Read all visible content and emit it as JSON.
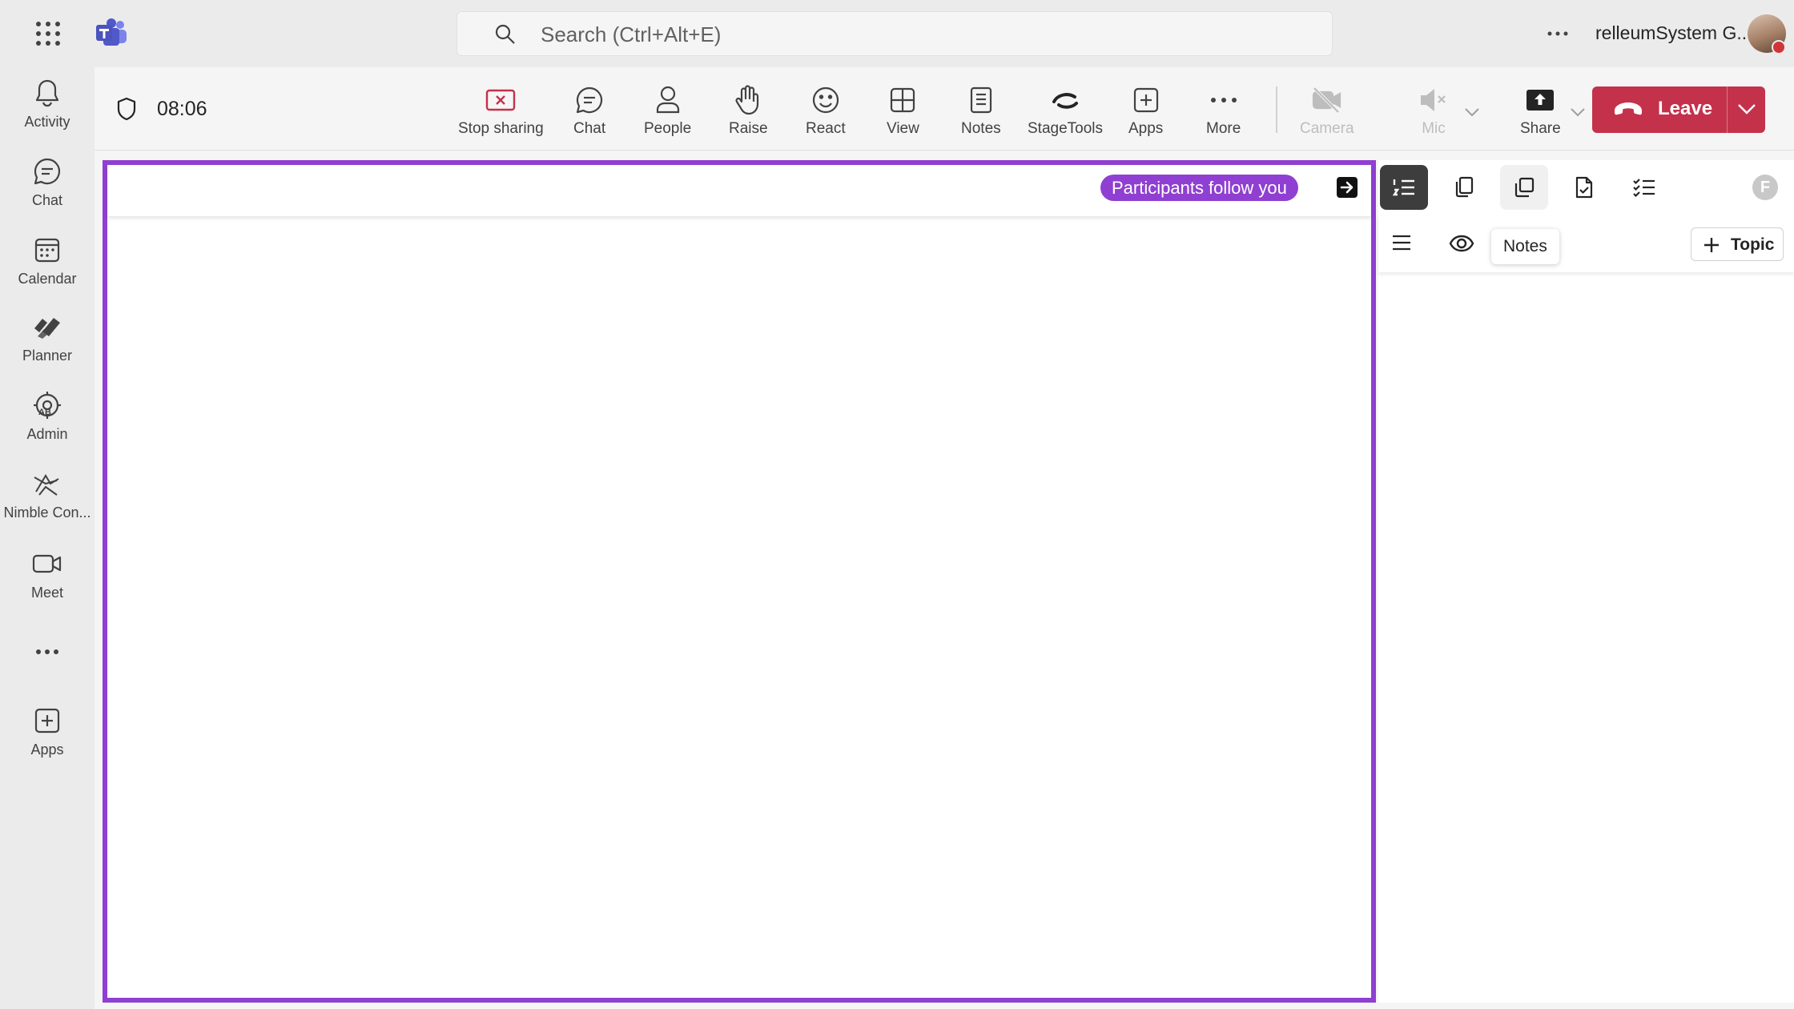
{
  "titlebar": {
    "search_placeholder": "Search (Ctrl+Alt+E)",
    "user_name": "relleumSystem G..."
  },
  "rail": {
    "items": [
      {
        "label": "Activity",
        "icon": "bell-icon"
      },
      {
        "label": "Chat",
        "icon": "chat-icon"
      },
      {
        "label": "Calendar",
        "icon": "calendar-icon"
      },
      {
        "label": "Planner",
        "icon": "planner-icon"
      },
      {
        "label": "Admin",
        "icon": "admin-icon"
      },
      {
        "label": "Nimble Con...",
        "icon": "nimble-icon"
      },
      {
        "label": "Meet",
        "icon": "video-icon"
      },
      {
        "label": "Apps",
        "icon": "add-apps-icon"
      }
    ]
  },
  "meeting": {
    "timer": "08:06",
    "toolbar": [
      {
        "label": "Stop sharing",
        "icon": "stop-sharing-icon"
      },
      {
        "label": "Chat",
        "icon": "chat-icon"
      },
      {
        "label": "People",
        "icon": "people-icon"
      },
      {
        "label": "Raise",
        "icon": "raise-hand-icon"
      },
      {
        "label": "React",
        "icon": "smiley-icon"
      },
      {
        "label": "View",
        "icon": "grid-view-icon"
      },
      {
        "label": "Notes",
        "icon": "notes-icon"
      },
      {
        "label": "StageTools",
        "icon": "stagetools-icon"
      },
      {
        "label": "Apps",
        "icon": "add-apps-icon"
      },
      {
        "label": "More",
        "icon": "more-icon"
      },
      {
        "label": "Camera",
        "icon": "camera-off-icon",
        "disabled": true
      },
      {
        "label": "Mic",
        "icon": "mic-muted-icon",
        "disabled": true
      },
      {
        "label": "Share",
        "icon": "share-icon"
      }
    ],
    "leave_label": "Leave",
    "colors": {
      "leave": "#c4314b",
      "stage_border": "#8f3fd1"
    }
  },
  "stage": {
    "follow_pill": "Participants follow you"
  },
  "panel": {
    "tabs": [
      "agenda-list-icon",
      "pages-icon",
      "notes-copy-icon",
      "document-check-icon",
      "tasks-list-icon"
    ],
    "avatar_initial": "F",
    "tooltip": "Notes",
    "topic_label": "Topic"
  }
}
